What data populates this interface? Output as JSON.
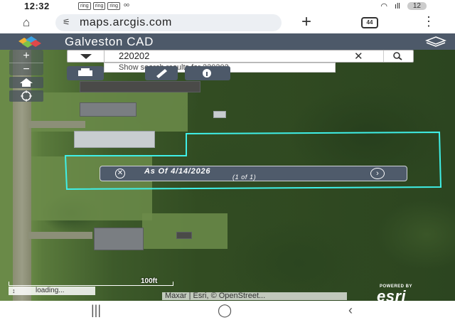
{
  "status_bar": {
    "time": "12:32",
    "notifications": [
      "ring",
      "ring",
      "ring"
    ],
    "voicemail": "oo",
    "signal": "ıll",
    "battery": "12"
  },
  "browser": {
    "url": "maps.arcgis.com",
    "tab_count": "44",
    "icons": [
      "home-icon",
      "tune-icon",
      "new-tab-icon",
      "tabs-icon",
      "menu-icon"
    ]
  },
  "app": {
    "title": "Galveston CAD"
  },
  "search": {
    "value": "220202",
    "suggestion": "Show search results for 220202"
  },
  "popup": {
    "title": "As Of 4/14/2026",
    "count": "(1 of 1)"
  },
  "map": {
    "scale_label": "100ft",
    "loading_text": "loading...",
    "attribution": "Maxar | Esri, © OpenStreet...",
    "esri_powered_by": "POWERED BY",
    "esri_brand": "esri",
    "parcel_outline_color": "#3ff0e8"
  },
  "colors": {
    "header": "#4d5969",
    "popup": "#4f5b6b"
  }
}
